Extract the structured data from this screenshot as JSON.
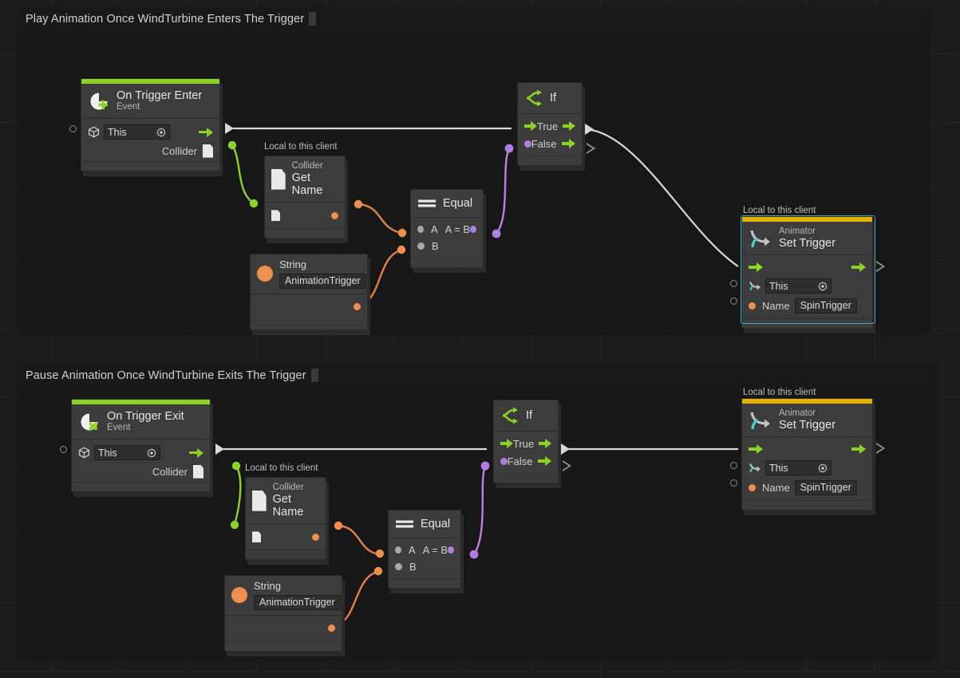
{
  "app": {
    "canvas_bg": "#1b1b1b",
    "accent_event": "#8cd423",
    "accent_animator": "#e3b100",
    "selection_color": "#3fa9c9"
  },
  "groups": [
    {
      "title": "Play Animation Once WindTurbine Enters The Trigger"
    },
    {
      "title": "Pause Animation Once WindTurbine Exits The Trigger"
    }
  ],
  "labels": {
    "local_to_client": "Local to this client"
  },
  "graph1": {
    "trigger_enter": {
      "title": "On Trigger Enter",
      "subtitle": "Event",
      "icon": "on-trigger-enter-icon",
      "target_value": "This",
      "output_label": "Collider"
    },
    "get_name": {
      "subtitle": "Collider",
      "title": "Get Name",
      "scope": "Local to this client",
      "icon": "document-icon"
    },
    "string_node": {
      "title": "String",
      "value": "AnimationTrigger",
      "icon": "string-orange-dot-icon"
    },
    "equal": {
      "title": "Equal",
      "icon": "equal-icon",
      "input_a": "A",
      "input_b": "B",
      "output": "A = B"
    },
    "if_node": {
      "title": "If",
      "icon": "branch-icon",
      "true_label": "True",
      "false_label": "False"
    },
    "animator": {
      "subtitle": "Animator",
      "title": "Set Trigger",
      "scope": "Local to this client",
      "icon": "animator-icon",
      "target_value": "This",
      "name_label": "Name",
      "name_value": "SpinTrigger",
      "selected": true
    }
  },
  "graph2": {
    "trigger_exit": {
      "title": "On Trigger Exit",
      "subtitle": "Event",
      "icon": "on-trigger-exit-icon",
      "target_value": "This",
      "output_label": "Collider"
    },
    "get_name": {
      "subtitle": "Collider",
      "title": "Get Name",
      "scope": "Local to this client",
      "icon": "document-icon"
    },
    "string_node": {
      "title": "String",
      "value": "AnimationTrigger",
      "icon": "string-orange-dot-icon"
    },
    "equal": {
      "title": "Equal",
      "icon": "equal-icon",
      "input_a": "A",
      "input_b": "B",
      "output": "A = B"
    },
    "if_node": {
      "title": "If",
      "icon": "branch-icon",
      "true_label": "True",
      "false_label": "False"
    },
    "animator": {
      "subtitle": "Animator",
      "title": "Set Trigger",
      "scope": "Local to this client",
      "icon": "animator-icon",
      "target_value": "This",
      "name_label": "Name",
      "name_value": "SpinTrigger",
      "selected": false
    }
  }
}
